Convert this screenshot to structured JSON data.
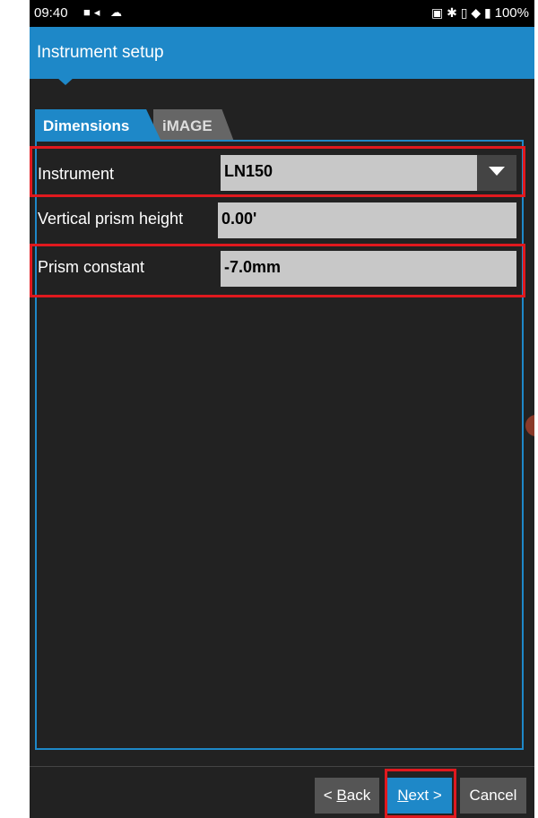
{
  "status_bar": {
    "time": "09:40",
    "left_icons": [
      "video-icon",
      "cloud-icon"
    ],
    "right_icons": [
      "nfc-icon",
      "bluetooth-icon",
      "vibrate-icon",
      "wifi-icon",
      "battery-icon"
    ],
    "battery_percent": "100%"
  },
  "app_bar": {
    "title": "Instrument setup",
    "color": "#1e88c8"
  },
  "tabs": [
    {
      "label": "Dimensions",
      "active": true
    },
    {
      "label": "iMAGE",
      "active": false
    }
  ],
  "form": {
    "instrument": {
      "label": "Instrument",
      "value": "LN150"
    },
    "vertical_prism_height": {
      "label": "Vertical prism height",
      "value": "0.00'"
    },
    "prism_constant": {
      "label": "Prism constant",
      "value": "-7.0mm"
    }
  },
  "buttons": {
    "back": {
      "prefix": "< ",
      "underlined": "B",
      "rest": "ack"
    },
    "next": {
      "underlined": "N",
      "rest": "ext >"
    },
    "cancel": {
      "label": "Cancel"
    }
  },
  "colors": {
    "accent": "#1e88c8",
    "highlight": "#e0191e",
    "background": "#222222"
  }
}
